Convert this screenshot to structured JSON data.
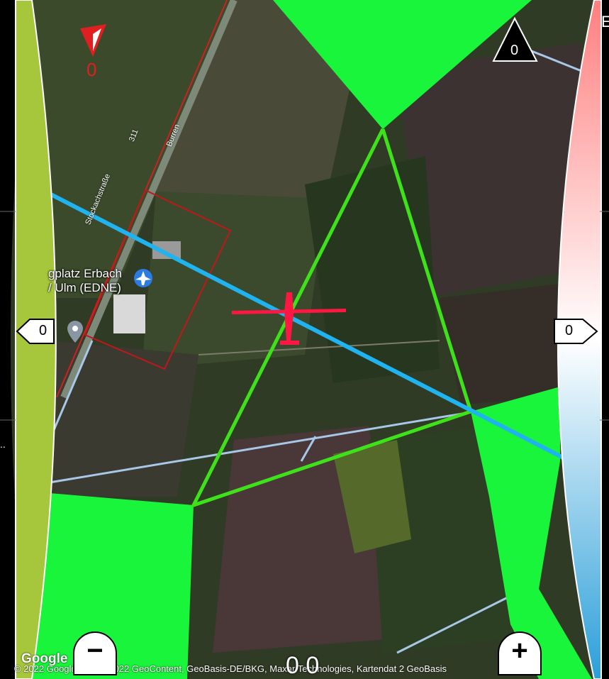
{
  "map": {
    "poi_line1": "gplatz Erbach",
    "poi_line2": "/ Ulm (EDNE)",
    "road_311": "311",
    "road_burren": "Burren",
    "road_stockach": "Stockachstraße",
    "google_logo": "Google",
    "attribution": "© 2022 Google  gery © 2022 GeoContent, GeoBasis-DE/BKG, Maxar Technologies, Kartendat       2 GeoBasis"
  },
  "wind": {
    "value": "0"
  },
  "compass": {
    "value": "0"
  },
  "left_indicator": {
    "value": "0"
  },
  "right_indicator": {
    "value": "0"
  },
  "speed": {
    "value": "0 0"
  },
  "zoom": {
    "minus_label": "−",
    "plus_label": "+"
  },
  "top_right_letter": "E",
  "left_dots": "..",
  "colors": {
    "left_bar": "#a6c63b",
    "right_bar_top": "#ff8a8a",
    "right_bar_bottom": "#2b9fd9",
    "task_green": "#19f53a",
    "track_line": "#1fb3f0",
    "airplane": "#ff1744"
  },
  "icons": [
    "wind-arrow-icon",
    "compass-triangle-icon",
    "airport-icon",
    "location-pin-icon",
    "glider-icon"
  ]
}
